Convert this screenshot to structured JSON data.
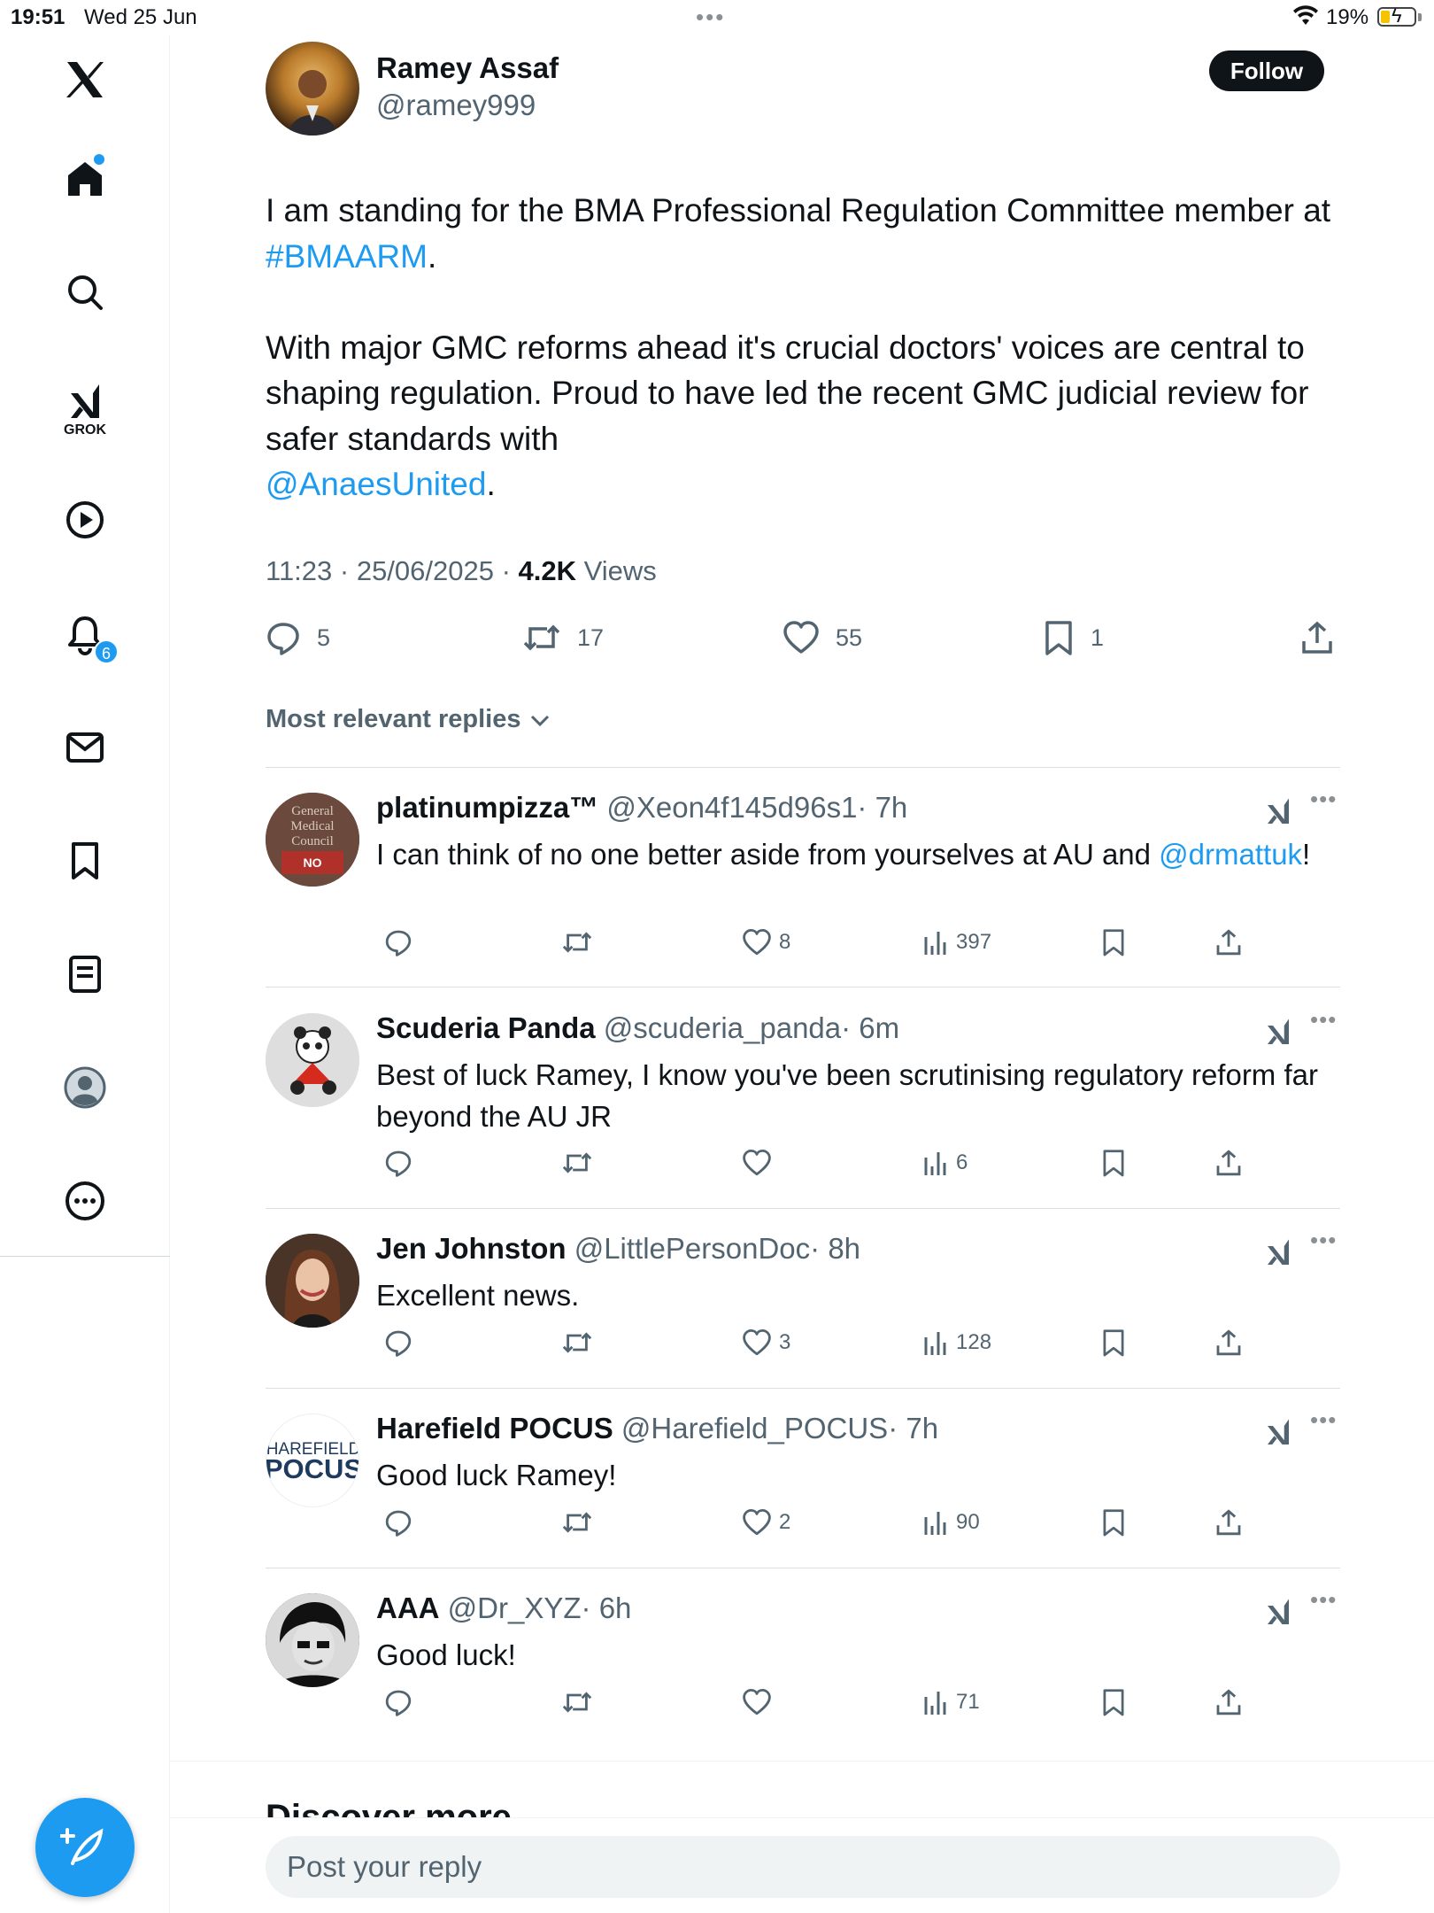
{
  "status_bar": {
    "time": "19:51",
    "date": "Wed 25 Jun",
    "battery": "19%"
  },
  "sidebar": {
    "grok_label": "GROK",
    "notifications_badge": "6",
    "icons": [
      "x-logo-icon",
      "home-icon",
      "search-icon",
      "grok-icon",
      "video-icon",
      "notifications-icon",
      "messages-icon",
      "bookmarks-icon",
      "lists-icon",
      "profile-icon",
      "more-icon",
      "compose-icon"
    ]
  },
  "post": {
    "author_name": "Ramey Assaf",
    "author_handle": "@ramey999",
    "follow_label": "Follow",
    "text_line1": "I am standing for the BMA Professional Regulation Committee member at ",
    "hashtag": "#BMAARM",
    "text_line1_end": ".",
    "text_para2": "With major GMC reforms ahead it's crucial doctors' voices are central to shaping regulation. Proud to have led the recent GMC judicial review for safer standards with",
    "mention": "@AnaesUnited",
    "text_para2_end": ".",
    "timestamp": "11:23 · 25/06/2025 · ",
    "views_count": "4.2K",
    "views_label": " Views",
    "replies": "5",
    "reposts": "17",
    "likes": "55",
    "bookmarks": "1"
  },
  "replies_sort_label": "Most relevant replies",
  "replies": [
    {
      "name": "platinumpizza™",
      "handle": "@Xeon4f145d96s1",
      "time": "· 7h",
      "text": "I can think of no one better aside from yourselves at AU and ",
      "mention": "@drmattuk",
      "text_end": "!",
      "likes": "8",
      "views": "397",
      "avatar_text": "General Medical Council"
    },
    {
      "name": "Scuderia Panda",
      "handle": "@scuderia_panda",
      "time": "· 6m",
      "text": "Best of luck Ramey, I know you've been scrutinising regulatory reform far beyond the AU JR",
      "likes": "",
      "views": "6"
    },
    {
      "name": "Jen Johnston",
      "handle": "@LittlePersonDoc",
      "time": "· 8h",
      "text": "Excellent news.",
      "likes": "3",
      "views": "128"
    },
    {
      "name": "Harefield POCUS",
      "handle": "@Harefield_POCUS",
      "time": "· 7h",
      "text": "Good luck Ramey!",
      "likes": "2",
      "views": "90",
      "avatar_text_top": "HAREFIELD",
      "avatar_text_bottom": "POCUS"
    },
    {
      "name": "AAA",
      "handle": "@Dr_XYZ",
      "time": "· 6h",
      "text": "Good luck!",
      "likes": "",
      "views": "71"
    }
  ],
  "discover_title": "Discover more",
  "reply_placeholder": "Post your reply",
  "colors": {
    "accent": "#1d9bf0",
    "text": "#0f1419",
    "secondary": "#536471"
  }
}
